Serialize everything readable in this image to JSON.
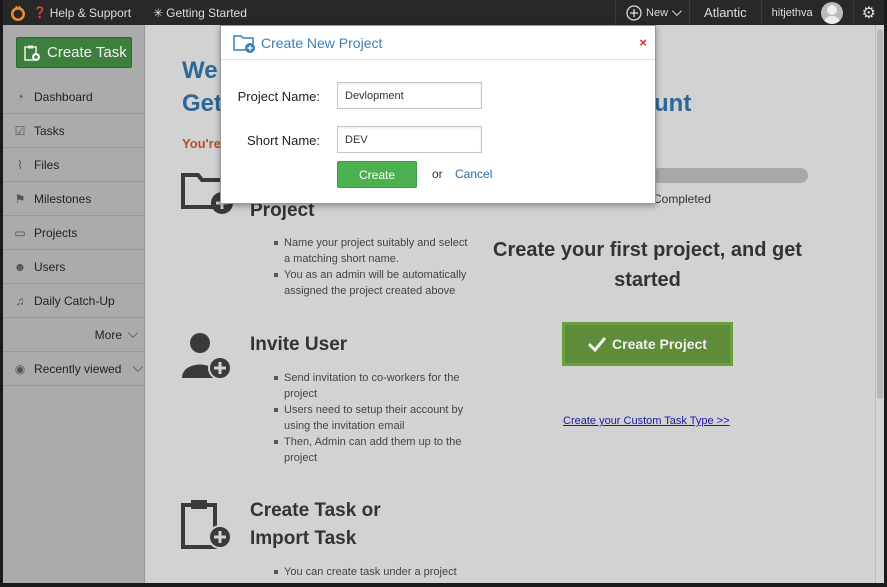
{
  "topbar": {
    "help_label": "Help & Support",
    "getting_started_label": "Getting Started",
    "new_label": "New",
    "company_label": "Atlantic",
    "username": "hitjethva"
  },
  "sidebar": {
    "create_task_label": "Create Task",
    "items": [
      {
        "label": "Dashboard",
        "icon": "dashboard-icon"
      },
      {
        "label": "Tasks",
        "icon": "tasks-icon"
      },
      {
        "label": "Files",
        "icon": "paperclip-icon"
      },
      {
        "label": "Milestones",
        "icon": "milestone-icon"
      },
      {
        "label": "Projects",
        "icon": "folder-icon"
      },
      {
        "label": "Users",
        "icon": "users-icon"
      },
      {
        "label": "Daily Catch-Up",
        "icon": "bell-icon"
      }
    ],
    "more_label": "More",
    "recently_viewed_label": "Recently viewed"
  },
  "main": {
    "welcome_line1": "We",
    "welcome_line2": "Get",
    "welcome_line2_end": "unt",
    "youre": "You're",
    "progress_label": "Completed",
    "steps": [
      {
        "title": "Project",
        "bullets": [
          "Name your project suitably and select a matching short name.",
          "You as an admin will be automatically assigned the project created above"
        ]
      },
      {
        "title": "Invite User",
        "bullets": [
          "Send invitation to co-workers for the project",
          "Users need to setup their account by using the invitation email",
          "Then, Admin can add them up to the project"
        ]
      },
      {
        "title_line1": "Create Task or",
        "title_line2": "Import Task",
        "bullets": [
          "You can create task under a project"
        ]
      }
    ],
    "cta_heading_line1": "Create your first project, and get",
    "cta_heading_line2": "started",
    "cta_button_label": "Create Project",
    "custom_task_link": "Create your Custom Task Type >>"
  },
  "modal": {
    "title": "Create New Project",
    "close_symbol": "×",
    "project_name_label": "Project Name:",
    "project_name_value": "Devlopment",
    "short_name_label": "Short Name:",
    "short_name_value": "DEV",
    "create_label": "Create",
    "or_label": "or",
    "cancel_label": "Cancel"
  },
  "colors": {
    "brand_green": "#4caf50",
    "link_blue": "#2d6aa3",
    "heading_blue": "#2e6797",
    "close_red": "#d0342c"
  }
}
